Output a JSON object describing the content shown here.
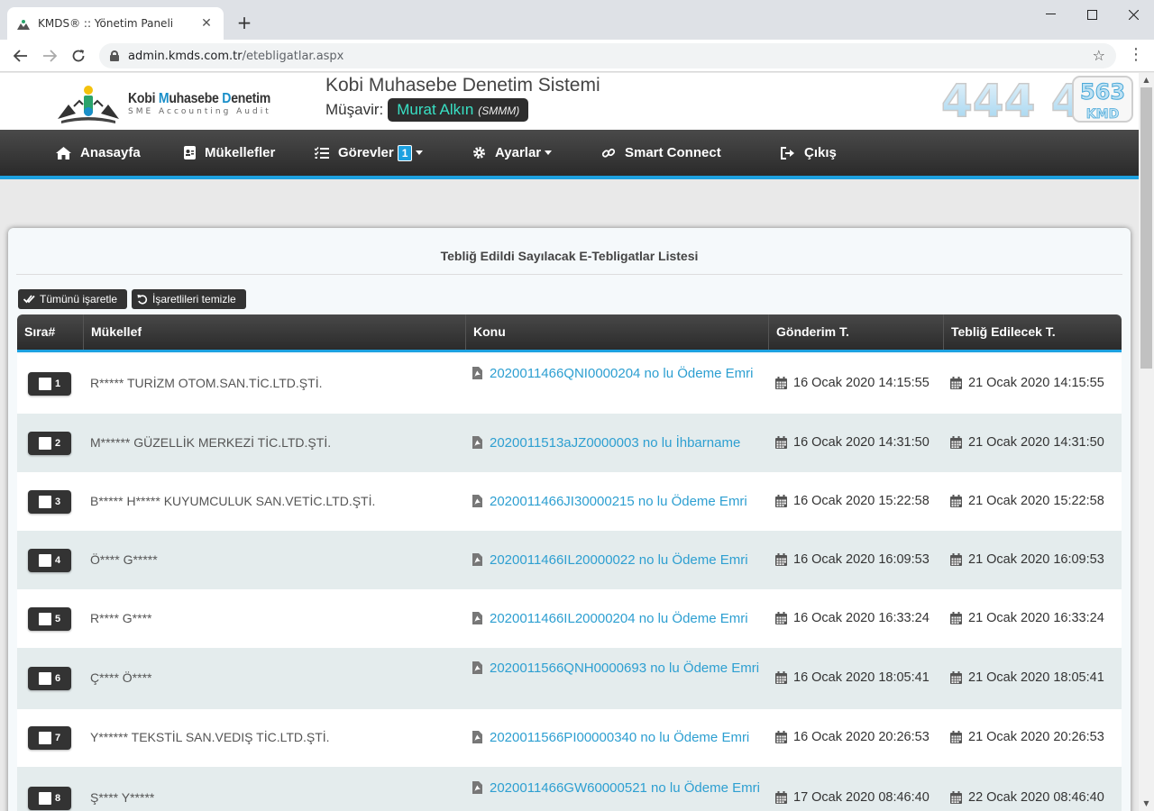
{
  "browser": {
    "tab_title": "KMDS® :: Yönetim Paneli",
    "url_host": "admin.kmds.com.tr",
    "url_path": "/etebligatlar.aspx"
  },
  "header": {
    "logo_line1_a": "Kobi ",
    "logo_line1_b": "M",
    "logo_line1_c": "uhasebe ",
    "logo_line1_d": "D",
    "logo_line1_e": "enetim",
    "logo_line2": "SME  Accounting  Audit",
    "system_title": "Kobi Muhasebe Denetim Sistemi",
    "advisor_label": "Müşavir:",
    "advisor_name": "Murat Alkın",
    "advisor_title": "(SMMM)",
    "phone_main": "444 4",
    "phone_num": "563",
    "phone_kmd": "KMD"
  },
  "nav": {
    "home": "Anasayfa",
    "taxpayers": "Mükellefler",
    "tasks": "Görevler",
    "tasks_badge": "1",
    "settings": "Ayarlar",
    "smart_connect": "Smart Connect",
    "logout": "Çıkış"
  },
  "list": {
    "title": "Tebliğ Edildi Sayılacak E-Tebligatlar Listesi",
    "select_all": "Tümünü işaretle",
    "clear_marks": "İşaretlileri temizle",
    "columns": {
      "index": "Sıra#",
      "taxpayer": "Mükellef",
      "subject": "Konu",
      "sent": "Gönderim T.",
      "notified": "Tebliğ Edilecek T."
    },
    "rows": [
      {
        "num": "1",
        "taxpayer": "R***** TURİZM OTOM.SAN.TİC.LTD.ŞTİ.",
        "subject": "2020011466QNI0000204 no lu Ödeme Emri",
        "sent": "16 Ocak 2020 14:15:55",
        "notified": "21 Ocak 2020 14:15:55"
      },
      {
        "num": "2",
        "taxpayer": "M****** GÜZELLİK MERKEZİ TİC.LTD.ŞTİ.",
        "subject": "2020011513aJZ0000003 no lu İhbarname",
        "sent": "16 Ocak 2020 14:31:50",
        "notified": "21 Ocak 2020 14:31:50"
      },
      {
        "num": "3",
        "taxpayer": "B***** H***** KUYUMCULUK SAN.VETİC.LTD.ŞTİ.",
        "subject": "2020011466JI30000215 no lu Ödeme Emri",
        "sent": "16 Ocak 2020 15:22:58",
        "notified": "21 Ocak 2020 15:22:58"
      },
      {
        "num": "4",
        "taxpayer": "Ö**** G*****",
        "subject": "2020011466IL20000022 no lu Ödeme Emri",
        "sent": "16 Ocak 2020 16:09:53",
        "notified": "21 Ocak 2020 16:09:53"
      },
      {
        "num": "5",
        "taxpayer": "R**** G****",
        "subject": "2020011466IL20000204 no lu Ödeme Emri",
        "sent": "16 Ocak 2020 16:33:24",
        "notified": "21 Ocak 2020 16:33:24"
      },
      {
        "num": "6",
        "taxpayer": "Ç**** Ö****",
        "subject": "2020011566QNH0000693 no lu Ödeme Emri",
        "sent": "16 Ocak 2020 18:05:41",
        "notified": "21 Ocak 2020 18:05:41"
      },
      {
        "num": "7",
        "taxpayer": "Y****** TEKSTİL SAN.VEDIŞ TİC.LTD.ŞTİ.",
        "subject": "2020011566PI00000340 no lu Ödeme Emri",
        "sent": "16 Ocak 2020 20:26:53",
        "notified": "21 Ocak 2020 20:26:53"
      },
      {
        "num": "8",
        "taxpayer": "Ş**** Y*****",
        "subject": "2020011466GW60000521 no lu Ödeme Emri",
        "sent": "17 Ocak 2020 08:46:40",
        "notified": "22 Ocak 2020 08:46:40"
      }
    ]
  }
}
